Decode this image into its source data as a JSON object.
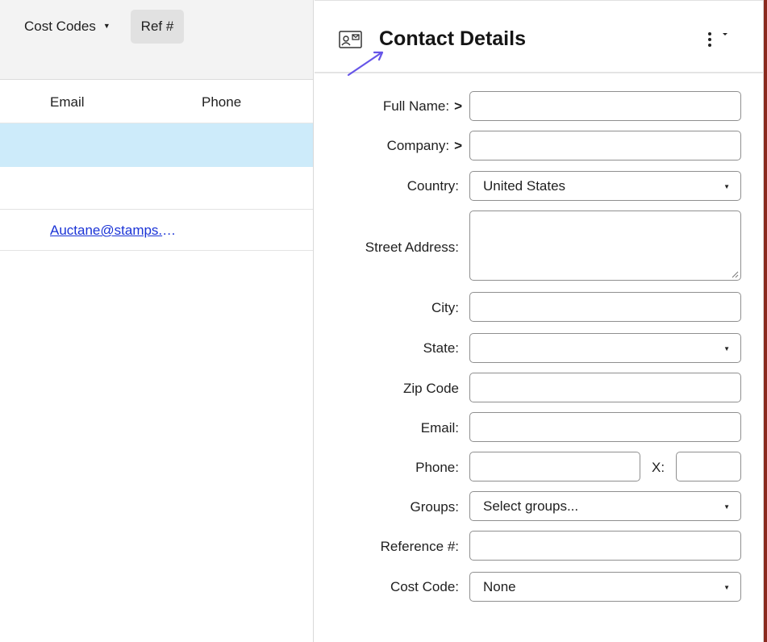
{
  "left": {
    "toolbar": {
      "cost_codes_label": "Cost Codes",
      "ref_label": "Ref #"
    },
    "columns": {
      "email": "Email",
      "phone": "Phone"
    },
    "rows": [
      {
        "email": "",
        "phone": ""
      },
      {
        "email": "",
        "phone": ""
      },
      {
        "email": "Auctane@stamps.com",
        "phone": ""
      }
    ]
  },
  "panel": {
    "title": "Contact Details",
    "icons": {
      "header": "contact-card-icon",
      "menu": "more-vertical-icon"
    },
    "fields": {
      "full_name": {
        "label": "Full Name:",
        "value": ""
      },
      "company": {
        "label": "Company:",
        "value": ""
      },
      "country": {
        "label": "Country:",
        "value": "United States"
      },
      "street_address": {
        "label": "Street Address:",
        "value": ""
      },
      "city": {
        "label": "City:",
        "value": ""
      },
      "state": {
        "label": "State:",
        "value": ""
      },
      "zip_code": {
        "label": "Zip Code",
        "value": ""
      },
      "email": {
        "label": "Email:",
        "value": ""
      },
      "phone": {
        "label": "Phone:",
        "value": "",
        "ext_label": "X:",
        "ext_value": ""
      },
      "groups": {
        "label": "Groups:",
        "value": "Select groups..."
      },
      "reference": {
        "label": "Reference #:",
        "value": ""
      },
      "cost_code": {
        "label": "Cost Code:",
        "value": "None"
      }
    }
  },
  "colors": {
    "selected_row": "#cdebfa",
    "link": "#1a33d6",
    "annotation_arrow": "#6655e8"
  }
}
